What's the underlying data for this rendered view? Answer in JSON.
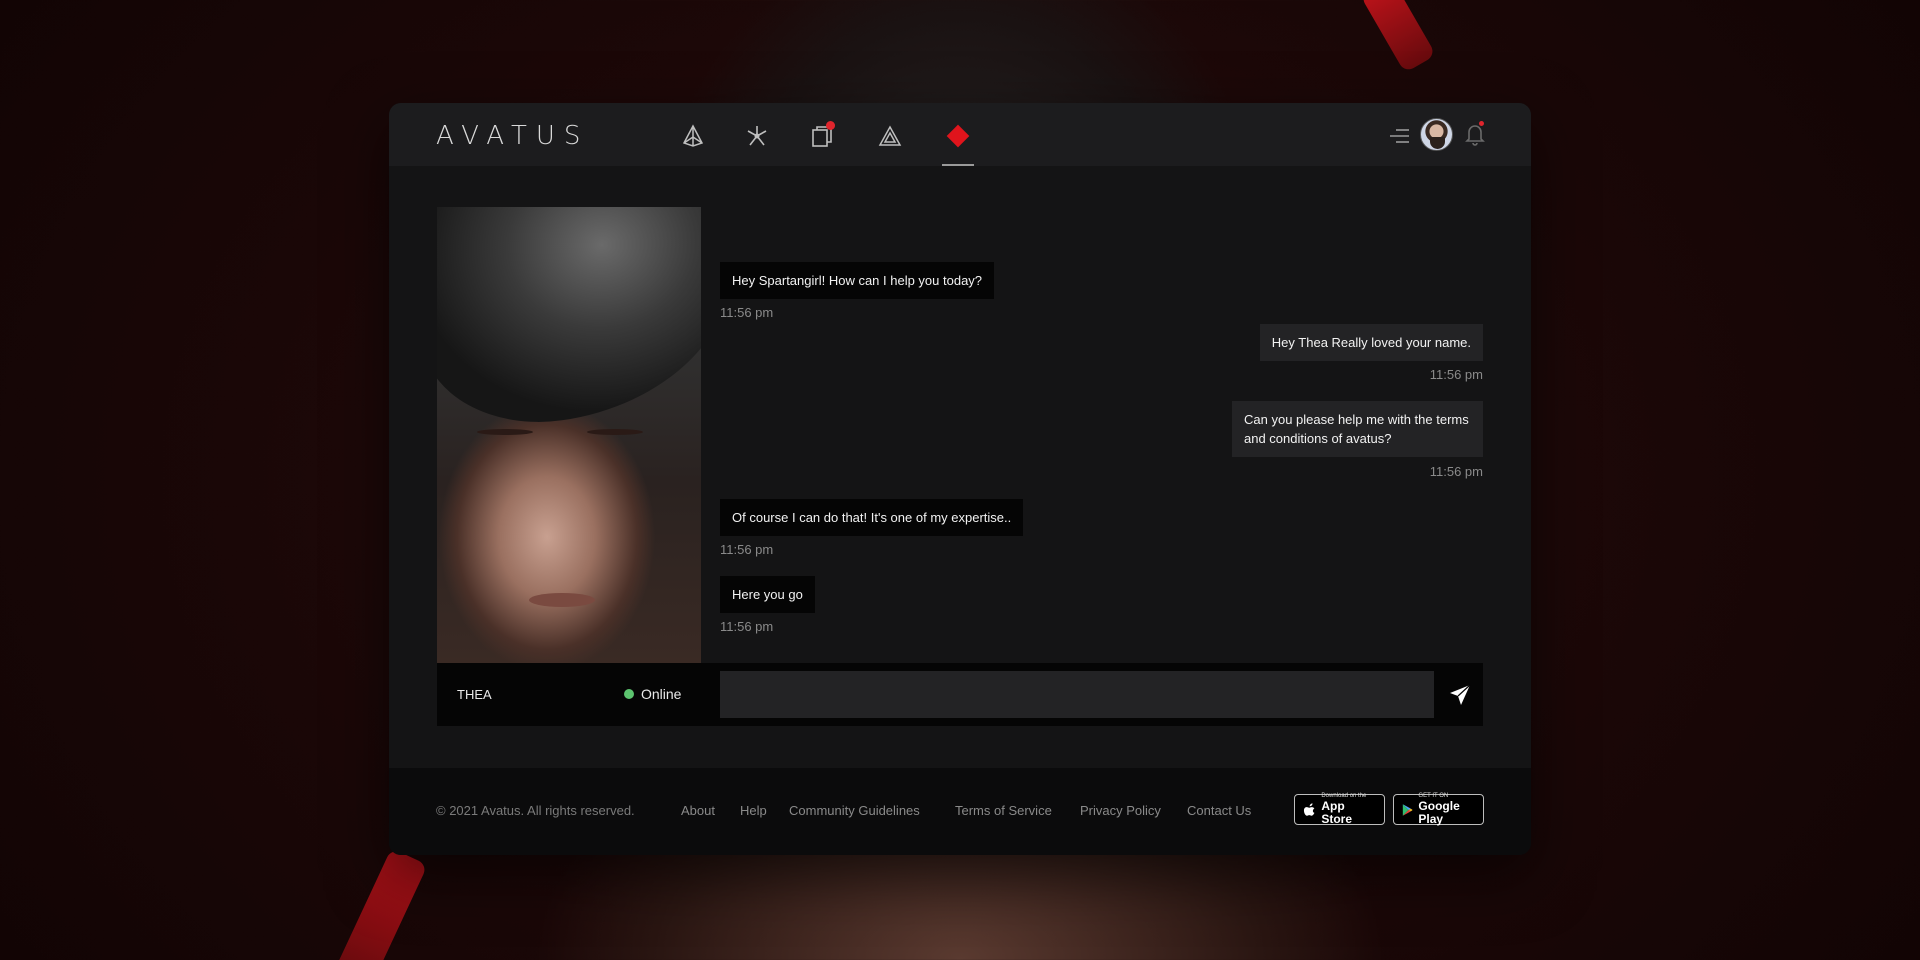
{
  "app": {
    "logo": "AVATUS",
    "accent_color": "#e0141c"
  },
  "nav": {
    "items": [
      {
        "icon": "pyramid-outline-icon"
      },
      {
        "icon": "network-nodes-icon"
      },
      {
        "icon": "stack-cards-icon",
        "has_badge": true
      },
      {
        "icon": "triangle-outline-icon"
      },
      {
        "icon": "red-diamond-icon",
        "active": true
      }
    ]
  },
  "header": {
    "menu_icon": "menu-lines-icon",
    "bell_icon": "bell-icon"
  },
  "chat": {
    "messages": [
      {
        "direction": "in",
        "text": "Hey Spartangirl! How can I help you today?",
        "time": "11:56 pm"
      },
      {
        "direction": "out",
        "text": "Hey Thea Really loved your name.",
        "time": "11:56 pm"
      },
      {
        "direction": "out",
        "text": "Can you please help me with the terms and conditions of avatus?",
        "time": "11:56 pm"
      },
      {
        "direction": "in",
        "text": "Of course I can do that! It's one of my expertise..",
        "time": "11:56 pm"
      },
      {
        "direction": "in",
        "text": "Here you go",
        "time": "11:56 pm"
      }
    ],
    "contact_name": "THEA",
    "status": "Online",
    "status_color": "#5cc46f",
    "input_value": "",
    "input_placeholder": ""
  },
  "footer": {
    "copyright": "© 2021 Avatus. All rights reserved.",
    "links": [
      "About",
      "Help",
      "Community Guidelines",
      "Terms of Service",
      "Privacy Policy",
      "Contact Us"
    ],
    "app_store": {
      "small": "Download on the",
      "big": "App Store"
    },
    "google_play": {
      "small": "GET IT ON",
      "big": "Google Play"
    }
  }
}
